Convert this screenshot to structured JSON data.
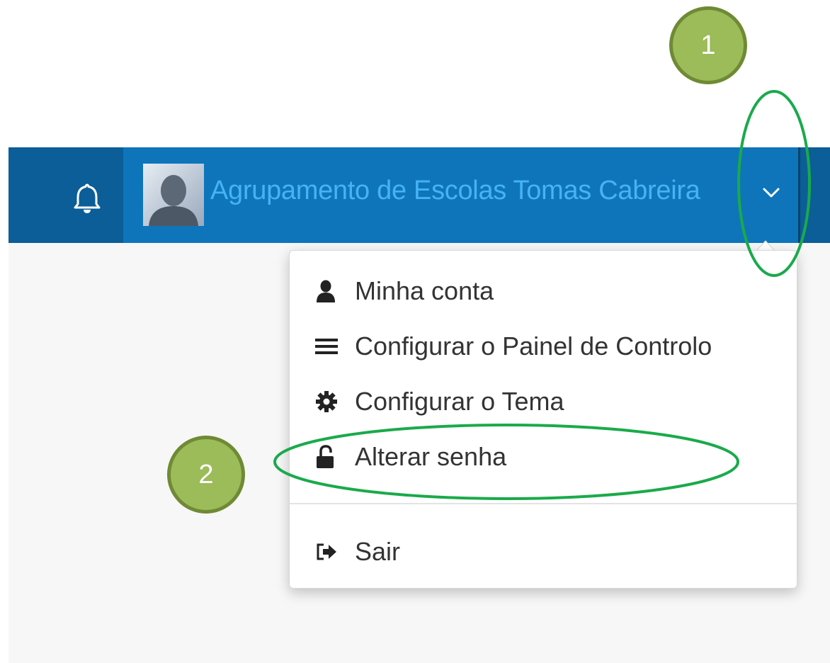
{
  "header": {
    "user_name": "Agrupamento de Escolas Tomas Cabreira"
  },
  "menu": {
    "items": [
      {
        "label": "Minha conta",
        "icon": "user-icon"
      },
      {
        "label": "Configurar o Painel de Controlo",
        "icon": "bars-icon"
      },
      {
        "label": "Configurar o Tema",
        "icon": "gear-icon"
      },
      {
        "label": "Alterar senha",
        "icon": "unlock-icon"
      },
      {
        "label": "Sair",
        "icon": "sign-out-icon"
      }
    ]
  },
  "annotations": {
    "step1": "1",
    "step2": "2"
  },
  "colors": {
    "topbar": "#0e75bb",
    "topbar_dark": "#0b5e97",
    "user_text": "#45b3f2",
    "annotation_green": "#1aaa4b",
    "badge_fill": "#9cbb59"
  }
}
